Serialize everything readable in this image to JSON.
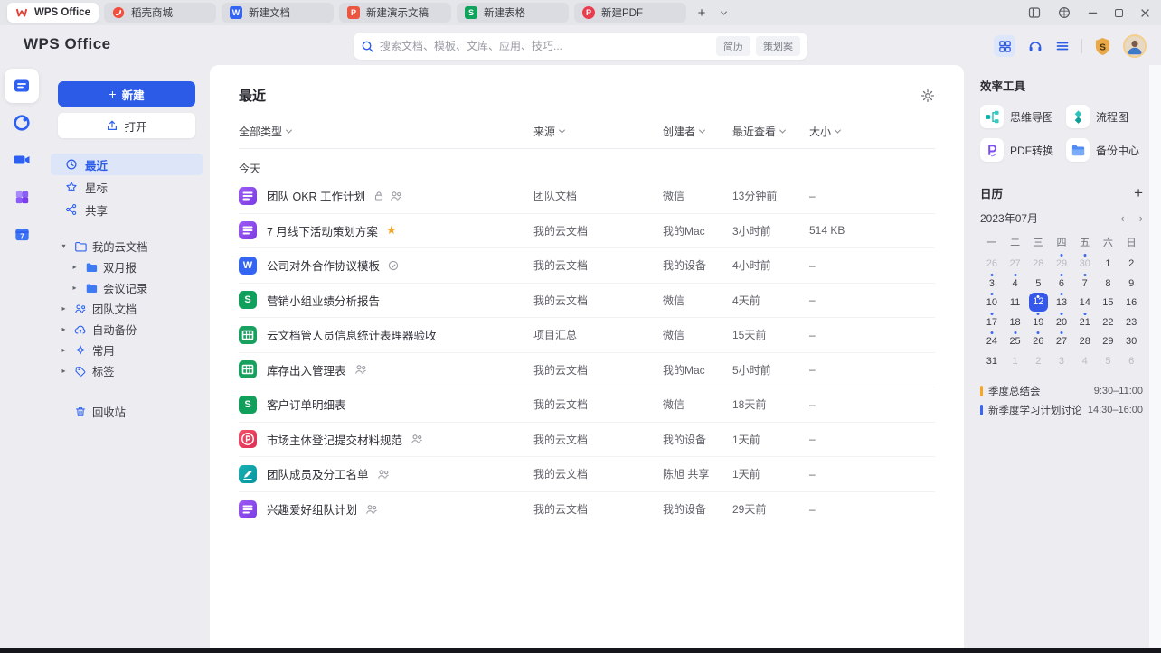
{
  "accent": "#2c5be8",
  "icons": {
    "plus": "+",
    "chevron_left": "‹",
    "chevron_right": "›",
    "expander_open": "▾",
    "expander_closed": "▸"
  },
  "tabbar": {
    "tabs": [
      {
        "label": "WPS Office",
        "type": "wps",
        "active": true
      },
      {
        "label": "稻壳商城",
        "type": "docer",
        "active": false
      },
      {
        "label": "新建文档",
        "type": "doc",
        "active": false
      },
      {
        "label": "新建演示文稿",
        "type": "ppt",
        "active": false
      },
      {
        "label": "新建表格",
        "type": "sheet",
        "active": false
      },
      {
        "label": "新建PDF",
        "type": "pdf",
        "active": false
      }
    ]
  },
  "header": {
    "logo": "WPS Office",
    "search": {
      "placeholder": "搜索文档、模板、文库、应用、技巧...",
      "tags": [
        "简历",
        "策划案"
      ]
    }
  },
  "sidebar": {
    "new_button": "新建",
    "open_button": "打开",
    "nav": [
      {
        "label": "最近",
        "active": true
      },
      {
        "label": "星标",
        "active": false
      },
      {
        "label": "共享",
        "active": false
      }
    ],
    "tree": [
      {
        "label": "我的云文档"
      },
      {
        "label": "双月报"
      },
      {
        "label": "会议记录"
      },
      {
        "label": "团队文档"
      },
      {
        "label": "自动备份"
      },
      {
        "label": "常用"
      },
      {
        "label": "标签"
      }
    ],
    "trash": "回收站"
  },
  "main": {
    "title": "最近",
    "filters": [
      "全部类型",
      "来源",
      "创建者",
      "最近查看",
      "大小"
    ],
    "group": "今天",
    "files": [
      {
        "type": "wpsdoc",
        "name": "团队 OKR 工作计划",
        "badges": [
          "lock",
          "team"
        ],
        "source": "团队文档",
        "creator": "微信",
        "viewed": "13分钟前",
        "size": "–"
      },
      {
        "type": "wpsdoc",
        "name": "7 月线下活动策划方案",
        "badges": [
          "star"
        ],
        "source": "我的云文档",
        "creator": "我的Mac",
        "viewed": "3小时前",
        "size": "514 KB"
      },
      {
        "type": "word",
        "name": "公司对外合作协议模板",
        "badges": [
          "shield"
        ],
        "source": "我的云文档",
        "creator": "我的设备",
        "viewed": "4小时前",
        "size": "–"
      },
      {
        "type": "sheet",
        "name": "营销小组业绩分析报告",
        "badges": [],
        "source": "我的云文档",
        "creator": "微信",
        "viewed": "4天前",
        "size": "–"
      },
      {
        "type": "grid",
        "name": "云文档管人员信息统计表理器验收",
        "badges": [],
        "source": "项目汇总",
        "creator": "微信",
        "viewed": "15天前",
        "size": "–"
      },
      {
        "type": "grid",
        "name": "库存出入管理表",
        "badges": [
          "team"
        ],
        "source": "我的云文档",
        "creator": "我的Mac",
        "viewed": "5小时前",
        "size": "–"
      },
      {
        "type": "sheet",
        "name": "客户订单明细表",
        "badges": [],
        "source": "我的云文档",
        "creator": "微信",
        "viewed": "18天前",
        "size": "–"
      },
      {
        "type": "pdf",
        "name": "市场主体登记提交材料规范",
        "badges": [
          "team"
        ],
        "source": "我的云文档",
        "creator": "我的设备",
        "viewed": "1天前",
        "size": "–"
      },
      {
        "type": "form",
        "name": "团队成员及分工名单",
        "badges": [
          "team"
        ],
        "source": "我的云文档",
        "creator": "陈旭 共享",
        "viewed": "1天前",
        "size": "–"
      },
      {
        "type": "wpsdoc",
        "name": "兴趣爱好组队计划",
        "badges": [
          "team"
        ],
        "source": "我的云文档",
        "creator": "我的设备",
        "viewed": "29天前",
        "size": "–"
      }
    ]
  },
  "tools": {
    "title": "效率工具",
    "items": [
      {
        "label": "思维导图"
      },
      {
        "label": "流程图"
      },
      {
        "label": "PDF转换"
      },
      {
        "label": "备份中心"
      }
    ]
  },
  "calendar": {
    "title": "日历",
    "month": "2023年07月",
    "weekdays": [
      "一",
      "二",
      "三",
      "四",
      "五",
      "六",
      "日"
    ],
    "days": [
      {
        "d": "26",
        "muted": true
      },
      {
        "d": "27",
        "muted": true
      },
      {
        "d": "28",
        "muted": true
      },
      {
        "d": "29",
        "muted": true,
        "dot": true
      },
      {
        "d": "30",
        "muted": true,
        "dot": true
      },
      {
        "d": "1"
      },
      {
        "d": "2"
      },
      {
        "d": "3",
        "dot": true
      },
      {
        "d": "4",
        "dot": true
      },
      {
        "d": "5"
      },
      {
        "d": "6",
        "dot": true
      },
      {
        "d": "7",
        "dot": true
      },
      {
        "d": "8"
      },
      {
        "d": "9"
      },
      {
        "d": "10",
        "dot": true
      },
      {
        "d": "11"
      },
      {
        "d": "12",
        "selected": true,
        "dot": true
      },
      {
        "d": "13",
        "dot": true
      },
      {
        "d": "14"
      },
      {
        "d": "15"
      },
      {
        "d": "16"
      },
      {
        "d": "17",
        "dot": true
      },
      {
        "d": "18"
      },
      {
        "d": "19",
        "dot": true
      },
      {
        "d": "20",
        "dot": true
      },
      {
        "d": "21",
        "dot": true
      },
      {
        "d": "22"
      },
      {
        "d": "23"
      },
      {
        "d": "24",
        "dot": true
      },
      {
        "d": "25",
        "dot": true
      },
      {
        "d": "26",
        "dot": true
      },
      {
        "d": "27",
        "dot": true
      },
      {
        "d": "28"
      },
      {
        "d": "29"
      },
      {
        "d": "30"
      },
      {
        "d": "31"
      },
      {
        "d": "1",
        "muted": true
      },
      {
        "d": "2",
        "muted": true
      },
      {
        "d": "3",
        "muted": true
      },
      {
        "d": "4",
        "muted": true
      },
      {
        "d": "5",
        "muted": true
      },
      {
        "d": "6",
        "muted": true
      }
    ],
    "events": [
      {
        "title": "季度总结会",
        "time": "9:30–11:00",
        "color": "#f5a623"
      },
      {
        "title": "新季度学习计划讨论",
        "time": "14:30–16:00",
        "color": "#3b66f5"
      }
    ]
  }
}
